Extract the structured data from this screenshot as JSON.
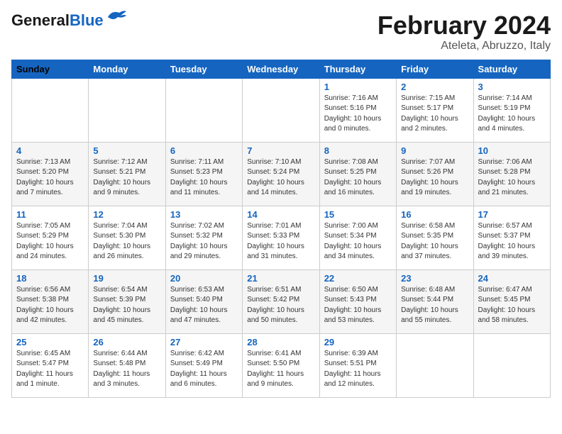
{
  "header": {
    "logo_line1": "General",
    "logo_line2": "Blue",
    "month": "February 2024",
    "location": "Ateleta, Abruzzo, Italy"
  },
  "weekdays": [
    "Sunday",
    "Monday",
    "Tuesday",
    "Wednesday",
    "Thursday",
    "Friday",
    "Saturday"
  ],
  "weeks": [
    [
      {
        "day": "",
        "info": ""
      },
      {
        "day": "",
        "info": ""
      },
      {
        "day": "",
        "info": ""
      },
      {
        "day": "",
        "info": ""
      },
      {
        "day": "1",
        "info": "Sunrise: 7:16 AM\nSunset: 5:16 PM\nDaylight: 10 hours\nand 0 minutes."
      },
      {
        "day": "2",
        "info": "Sunrise: 7:15 AM\nSunset: 5:17 PM\nDaylight: 10 hours\nand 2 minutes."
      },
      {
        "day": "3",
        "info": "Sunrise: 7:14 AM\nSunset: 5:19 PM\nDaylight: 10 hours\nand 4 minutes."
      }
    ],
    [
      {
        "day": "4",
        "info": "Sunrise: 7:13 AM\nSunset: 5:20 PM\nDaylight: 10 hours\nand 7 minutes."
      },
      {
        "day": "5",
        "info": "Sunrise: 7:12 AM\nSunset: 5:21 PM\nDaylight: 10 hours\nand 9 minutes."
      },
      {
        "day": "6",
        "info": "Sunrise: 7:11 AM\nSunset: 5:23 PM\nDaylight: 10 hours\nand 11 minutes."
      },
      {
        "day": "7",
        "info": "Sunrise: 7:10 AM\nSunset: 5:24 PM\nDaylight: 10 hours\nand 14 minutes."
      },
      {
        "day": "8",
        "info": "Sunrise: 7:08 AM\nSunset: 5:25 PM\nDaylight: 10 hours\nand 16 minutes."
      },
      {
        "day": "9",
        "info": "Sunrise: 7:07 AM\nSunset: 5:26 PM\nDaylight: 10 hours\nand 19 minutes."
      },
      {
        "day": "10",
        "info": "Sunrise: 7:06 AM\nSunset: 5:28 PM\nDaylight: 10 hours\nand 21 minutes."
      }
    ],
    [
      {
        "day": "11",
        "info": "Sunrise: 7:05 AM\nSunset: 5:29 PM\nDaylight: 10 hours\nand 24 minutes."
      },
      {
        "day": "12",
        "info": "Sunrise: 7:04 AM\nSunset: 5:30 PM\nDaylight: 10 hours\nand 26 minutes."
      },
      {
        "day": "13",
        "info": "Sunrise: 7:02 AM\nSunset: 5:32 PM\nDaylight: 10 hours\nand 29 minutes."
      },
      {
        "day": "14",
        "info": "Sunrise: 7:01 AM\nSunset: 5:33 PM\nDaylight: 10 hours\nand 31 minutes."
      },
      {
        "day": "15",
        "info": "Sunrise: 7:00 AM\nSunset: 5:34 PM\nDaylight: 10 hours\nand 34 minutes."
      },
      {
        "day": "16",
        "info": "Sunrise: 6:58 AM\nSunset: 5:35 PM\nDaylight: 10 hours\nand 37 minutes."
      },
      {
        "day": "17",
        "info": "Sunrise: 6:57 AM\nSunset: 5:37 PM\nDaylight: 10 hours\nand 39 minutes."
      }
    ],
    [
      {
        "day": "18",
        "info": "Sunrise: 6:56 AM\nSunset: 5:38 PM\nDaylight: 10 hours\nand 42 minutes."
      },
      {
        "day": "19",
        "info": "Sunrise: 6:54 AM\nSunset: 5:39 PM\nDaylight: 10 hours\nand 45 minutes."
      },
      {
        "day": "20",
        "info": "Sunrise: 6:53 AM\nSunset: 5:40 PM\nDaylight: 10 hours\nand 47 minutes."
      },
      {
        "day": "21",
        "info": "Sunrise: 6:51 AM\nSunset: 5:42 PM\nDaylight: 10 hours\nand 50 minutes."
      },
      {
        "day": "22",
        "info": "Sunrise: 6:50 AM\nSunset: 5:43 PM\nDaylight: 10 hours\nand 53 minutes."
      },
      {
        "day": "23",
        "info": "Sunrise: 6:48 AM\nSunset: 5:44 PM\nDaylight: 10 hours\nand 55 minutes."
      },
      {
        "day": "24",
        "info": "Sunrise: 6:47 AM\nSunset: 5:45 PM\nDaylight: 10 hours\nand 58 minutes."
      }
    ],
    [
      {
        "day": "25",
        "info": "Sunrise: 6:45 AM\nSunset: 5:47 PM\nDaylight: 11 hours\nand 1 minute."
      },
      {
        "day": "26",
        "info": "Sunrise: 6:44 AM\nSunset: 5:48 PM\nDaylight: 11 hours\nand 3 minutes."
      },
      {
        "day": "27",
        "info": "Sunrise: 6:42 AM\nSunset: 5:49 PM\nDaylight: 11 hours\nand 6 minutes."
      },
      {
        "day": "28",
        "info": "Sunrise: 6:41 AM\nSunset: 5:50 PM\nDaylight: 11 hours\nand 9 minutes."
      },
      {
        "day": "29",
        "info": "Sunrise: 6:39 AM\nSunset: 5:51 PM\nDaylight: 11 hours\nand 12 minutes."
      },
      {
        "day": "",
        "info": ""
      },
      {
        "day": "",
        "info": ""
      }
    ]
  ]
}
